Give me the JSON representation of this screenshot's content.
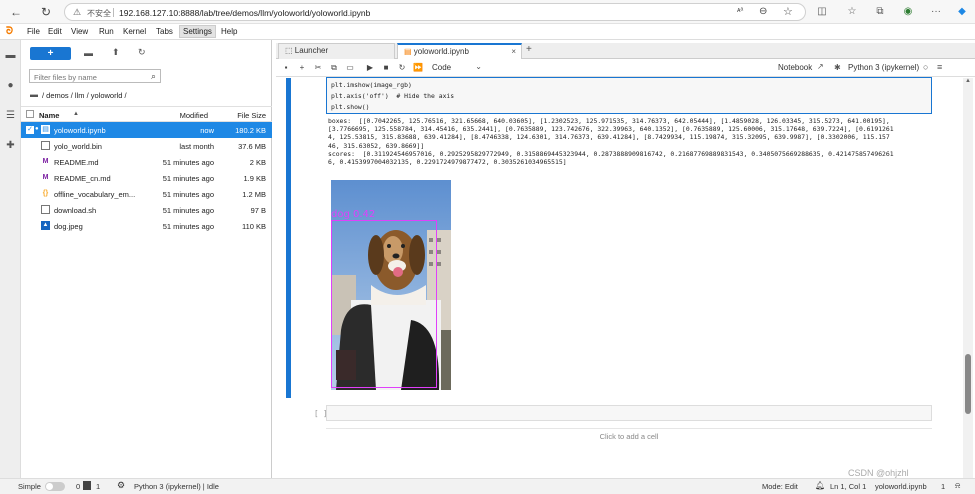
{
  "browser": {
    "security_label": "不安全",
    "url": "192.168.127.10:8888/lab/tree/demos/llm/yoloworld/yoloworld.ipynb",
    "zoom_badge": "ᴀᵃ"
  },
  "menu": {
    "items": [
      "File",
      "Edit",
      "View",
      "Run",
      "Kernel",
      "Tabs",
      "Settings",
      "Help"
    ]
  },
  "filebrowser": {
    "new_label": "+",
    "filter_placeholder": "Filter files by name",
    "breadcrumb": "/ demos / llm / yoloworld /",
    "headers": {
      "name": "Name",
      "modified": "Modified",
      "size": "File Size"
    },
    "files": [
      {
        "name": "yoloworld.ipynb",
        "modified": "now",
        "size": "180.2 KB",
        "icon": "notebook-icon",
        "selected": true
      },
      {
        "name": "yolo_world.bin",
        "modified": "last month",
        "size": "37.6 MB",
        "icon": "file-icon"
      },
      {
        "name": "README.md",
        "modified": "51 minutes ago",
        "size": "2 KB",
        "icon": "markdown-icon"
      },
      {
        "name": "README_cn.md",
        "modified": "51 minutes ago",
        "size": "1.9 KB",
        "icon": "markdown-icon"
      },
      {
        "name": "offline_vocabulary_em...",
        "modified": "51 minutes ago",
        "size": "1.2 MB",
        "icon": "json-icon"
      },
      {
        "name": "download.sh",
        "modified": "51 minutes ago",
        "size": "97 B",
        "icon": "file-icon"
      },
      {
        "name": "dog.jpeg",
        "modified": "51 minutes ago",
        "size": "110 KB",
        "icon": "image-icon"
      }
    ]
  },
  "tabs": [
    {
      "label": "Launcher",
      "active": false
    },
    {
      "label": "yoloworld.ipynb",
      "active": true
    }
  ],
  "toolbar": {
    "cell_type": "Code",
    "notebook_label": "Notebook",
    "kernel_label": "Python 3 (ipykernel)"
  },
  "cell": {
    "code_lines": [
      "plt.imshow(image_rgb)",
      "plt.axis('off')  # Hide the axis",
      "plt.show()"
    ],
    "output_lines": [
      "boxes:  [[0.7042265, 125.76516, 321.65668, 640.03605], [1.2302523, 125.971535, 314.76373, 642.05444], [1.4859028, 126.03345, 315.5273, 641.00195],",
      "[3.7766695, 125.558784, 314.45416, 635.2441], [0.7635889, 123.742676, 322.39963, 640.1352], [0.7635889, 125.60006, 315.17648, 639.7224], [0.6191261",
      "4, 125.53815, 315.83688, 639.41284], [8.4746338, 124.6301, 314.76373, 639.41284], [8.7429934, 115.19874, 315.32095, 639.9987], [0.3302006, 115.157",
      "46, 315.63052, 639.8669]]",
      "scores:  [0.311924546957016, 0.2925295829772949, 0.3158869445323944, 0.2873888909816742, 0.21687769889831543, 0.3405075669288635, 0.421475857496261",
      "6, 0.4153997004032135, 0.2291724979877472, 0.3035261034965515]"
    ],
    "detection_label": "dog 0.42",
    "empty_cell_prompt": "[ ]:",
    "add_cell_hint": "Click to add a cell"
  },
  "status": {
    "mode_label": "Simple",
    "count_a": "0",
    "count_b": "1",
    "kernel": "Python 3 (ipykernel) | Idle",
    "edit_mode": "Mode: Edit",
    "cursor": "Ln 1, Col 1",
    "filename": "yoloworld.ipynb",
    "count_c": "1"
  },
  "watermark": "CSDN @ohjzhl",
  "colors": {
    "accent": "#1976d2",
    "selected_row": "#1e88e5",
    "detection_box": "#e040fb"
  }
}
